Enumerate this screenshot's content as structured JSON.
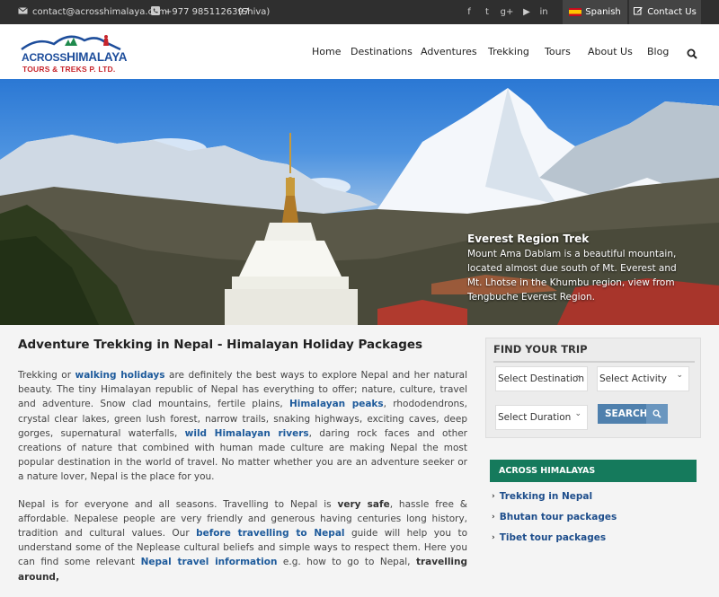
{
  "topbar": {
    "email": "contact@acrosshimalaya.com",
    "phone": "+977 9851126397",
    "contact_name": "(Shiva)",
    "social_icons": [
      "facebook-icon",
      "twitter-icon",
      "google-plus-icon",
      "youtube-icon",
      "linkedin-icon"
    ],
    "social_glyphs": [
      "f",
      "t",
      "g+",
      "▶",
      "in"
    ],
    "language_label": "Spanish",
    "contact_button": "Contact Us"
  },
  "logo": {
    "brand_a": "ACROSS",
    "brand_b": "HIMALAYA",
    "subtitle": "TOURS & TREKS P. LTD."
  },
  "nav": {
    "items": [
      "Home",
      "Destinations",
      "Adventures",
      "Trekking",
      "Tours",
      "About Us",
      "Blog"
    ]
  },
  "hero": {
    "caption_title": "Everest Region Trek",
    "caption_text": "Mount Ama Dablam is a beautiful mountain, located almost due south of Mt. Everest and Mt. Lhotse in the Khumbu region, view from Tengbuche Everest Region."
  },
  "main": {
    "title": "Adventure Trekking in Nepal - Himalayan Holiday Packages",
    "p1": {
      "a": "Trekking or ",
      "link1": "walking holidays",
      "b": " are definitely the best ways to explore Nepal and her natural beauty. The tiny Himalayan republic of Nepal has everything to offer; nature, culture, travel and adventure. Snow clad mountains, fertile plains, ",
      "link2": "Himalayan peaks",
      "c": ", rhododendrons, crystal clear lakes, green lush forest, narrow trails, snaking highways, exciting caves, deep gorges, supernatural waterfalls, ",
      "link3": "wild Himalayan rivers",
      "d": ", daring rock faces and other creations of nature that combined with human made culture are making Nepal the most popular destination in the world of travel. No matter whether you are an adventure seeker or a nature lover, Nepal is the place for you."
    },
    "p2": {
      "a": "Nepal is for everyone and all seasons. Travelling to Nepal is ",
      "bold1": "very safe",
      "b": ", hassle free & affordable. Nepalese people are very friendly and generous having centuries long history, tradition and cultural values. Our ",
      "link1": "before travelling to Nepal",
      "c": " guide will help you to understand some of the Neplease cultural beliefs and simple ways to respect them. Here you can find some relevant ",
      "link2": "Nepal travel information",
      "d": " e.g. how to go to Nepal, ",
      "bold2": "travelling around,"
    }
  },
  "find_trip": {
    "title": "FIND YOUR TRIP",
    "destination": "Select Destination",
    "activity": "Select Activity",
    "duration": "Select Duration",
    "search": "SEARCH"
  },
  "sidebar": {
    "heading": "ACROSS HIMALAYAS",
    "links": [
      "Trekking in Nepal",
      "Bhutan tour packages",
      "Tibet tour packages"
    ]
  }
}
